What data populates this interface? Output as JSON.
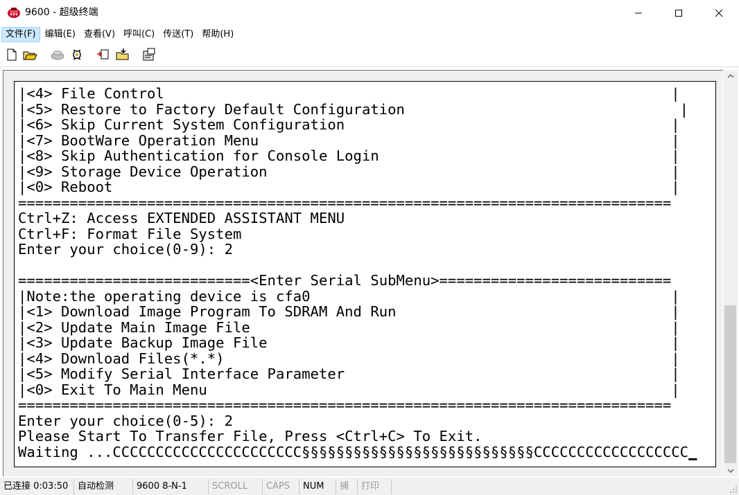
{
  "window": {
    "title": "9600 - 超级终端",
    "app_icon": "phone-icon",
    "controls": [
      "minimize-icon",
      "maximize-icon",
      "close-icon"
    ]
  },
  "menu": {
    "items": [
      {
        "label": "文件(F)",
        "active": true
      },
      {
        "label": "编辑(E)"
      },
      {
        "label": "查看(V)"
      },
      {
        "label": "呼叫(C)"
      },
      {
        "label": "传送(T)"
      },
      {
        "label": "帮助(H)"
      }
    ]
  },
  "toolbar": {
    "buttons": [
      "new-icon",
      "open-icon",
      "disconnect-icon",
      "connect-icon",
      "send-icon",
      "receive-icon",
      "properties-icon"
    ]
  },
  "terminal": {
    "lines": [
      "|<4> File Control                                                           |",
      "|<5> Restore to Factory Default Configuration                                |",
      "|<6> Skip Current System Configuration                                      |",
      "|<7> BootWare Operation Menu                                                |",
      "|<8> Skip Authentication for Console Login                                  |",
      "|<9> Storage Device Operation                                               |",
      "|<0> Reboot                                                                 |",
      "============================================================================",
      "Ctrl+Z: Access EXTENDED ASSISTANT MENU",
      "Ctrl+F: Format File System",
      "Enter your choice(0-9): 2",
      "",
      "===========================<Enter Serial SubMenu>===========================",
      "|Note:the operating device is cfa0                                          |",
      "|<1> Download Image Program To SDRAM And Run                                |",
      "|<2> Update Main Image File                                                 |",
      "|<3> Update Backup Image File                                               |",
      "|<4> Download Files(*.*)                                                    |",
      "|<5> Modify Serial Interface Parameter                                      |",
      "|<0> Exit To Main Menu                                                      |",
      "============================================================================",
      "Enter your choice(0-5): 2",
      "Please Start To Transfer File, Press <Ctrl+C> To Exit.",
      "Waiting ...CCCCCCCCCCCCCCCCCCCCCC§§§§§§§§§§§§§§§§§§§§§§§§§§§CCCCCCCCCCCCCCCCCC"
    ],
    "cursor": "_"
  },
  "statusbar": {
    "connected": "已连接 0:03:50",
    "detect": "自动检测",
    "settings": "9600 8-N-1",
    "scroll": "SCROLL",
    "caps": "CAPS",
    "num": "NUM",
    "capture": "捕",
    "print": "打印"
  }
}
